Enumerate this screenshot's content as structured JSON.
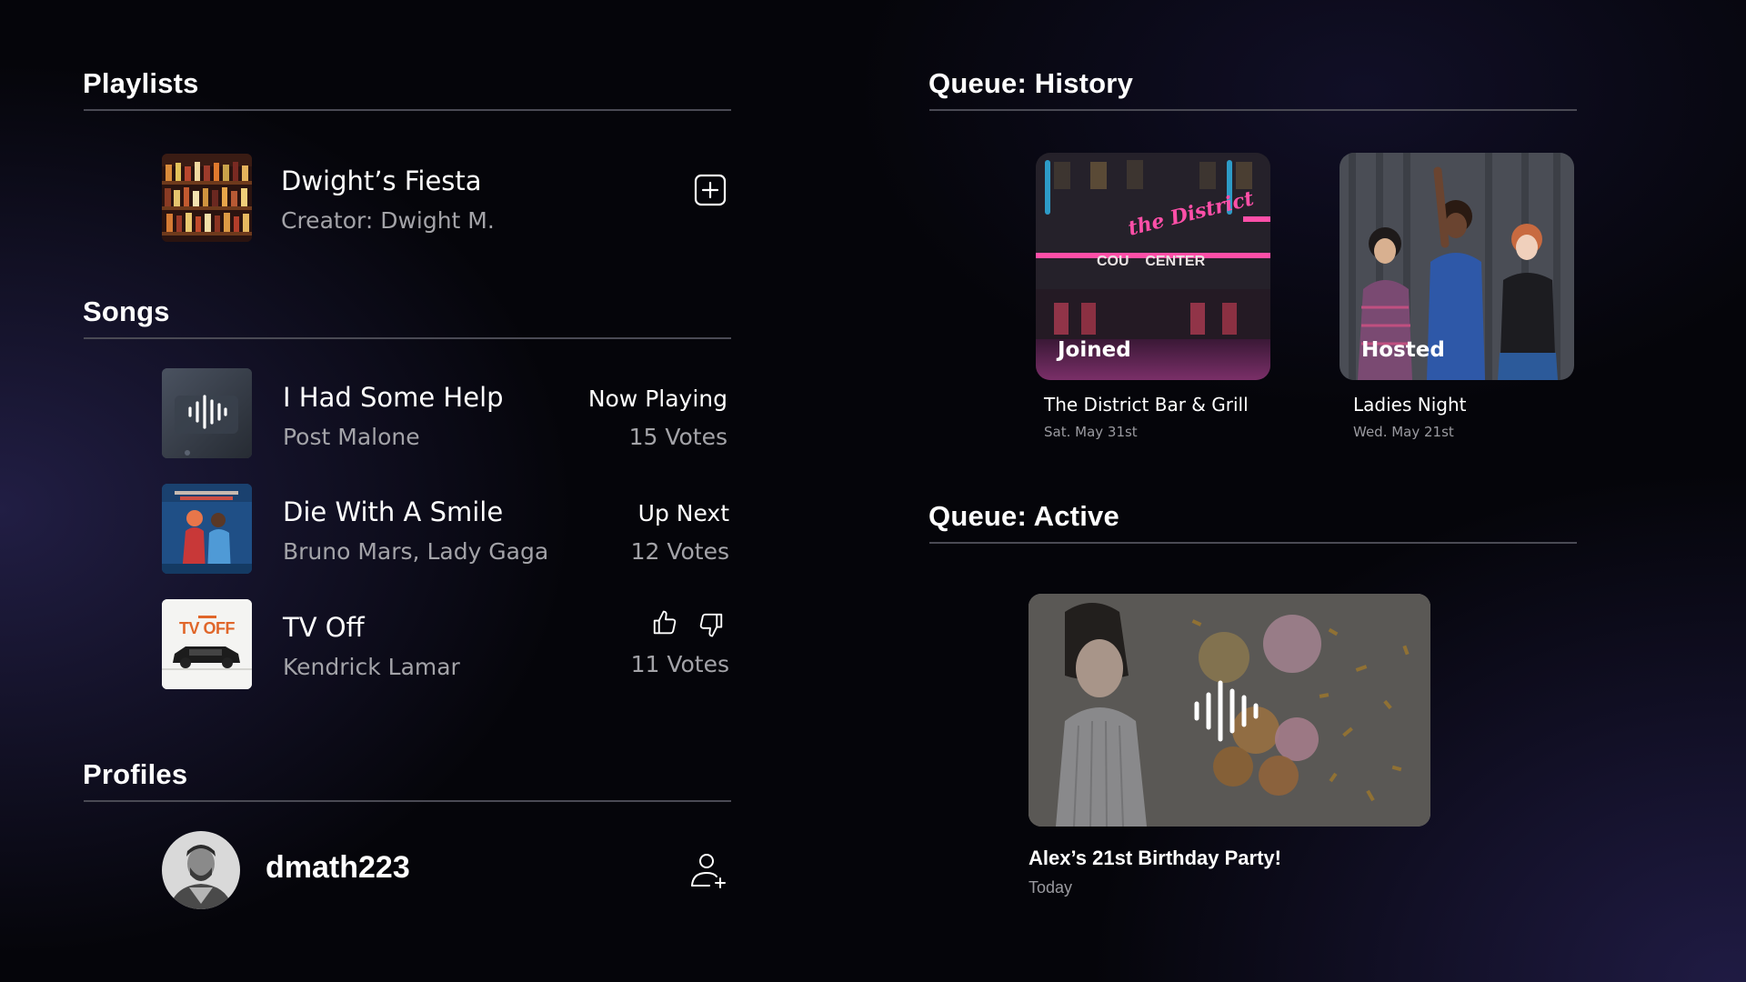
{
  "playlists": {
    "title": "Playlists",
    "item": {
      "name": "Dwight’s Fiesta",
      "creator": "Creator: Dwight M."
    }
  },
  "songs": {
    "title": "Songs",
    "items": [
      {
        "title": "I Had Some Help",
        "artist": "Post Malone",
        "status": "Now Playing",
        "votes": "15 Votes"
      },
      {
        "title": "Die With A Smile",
        "artist": "Bruno Mars, Lady Gaga",
        "status": "Up Next",
        "votes": "12 Votes"
      },
      {
        "title": "TV Off",
        "artist": "Kendrick Lamar",
        "votes": "11 Votes",
        "cover_text": "TV OFF"
      }
    ]
  },
  "profiles": {
    "title": "Profiles",
    "item": {
      "username": "dmath223"
    }
  },
  "queue_history": {
    "title": "Queue: History",
    "items": [
      {
        "label": "Joined",
        "name": "The District Bar & Grill",
        "date": "Sat. May 31st",
        "sign_text": "the District",
        "storefront_text": "COU    CENTER"
      },
      {
        "label": "Hosted",
        "name": "Ladies Night",
        "date": "Wed. May 21st"
      }
    ]
  },
  "queue_active": {
    "title": "Queue: Active",
    "item": {
      "name": "Alex’s 21st Birthday Party!",
      "date": "Today"
    }
  },
  "icons": [
    "add-square-icon",
    "waveform-icon",
    "thumbs-up-icon",
    "thumbs-down-icon",
    "add-user-icon"
  ],
  "colors": {
    "background": "#05050a",
    "muted_text": "#a3a3a8",
    "divider": "#4a4a54",
    "accent_neon": "#ff4fa8"
  }
}
